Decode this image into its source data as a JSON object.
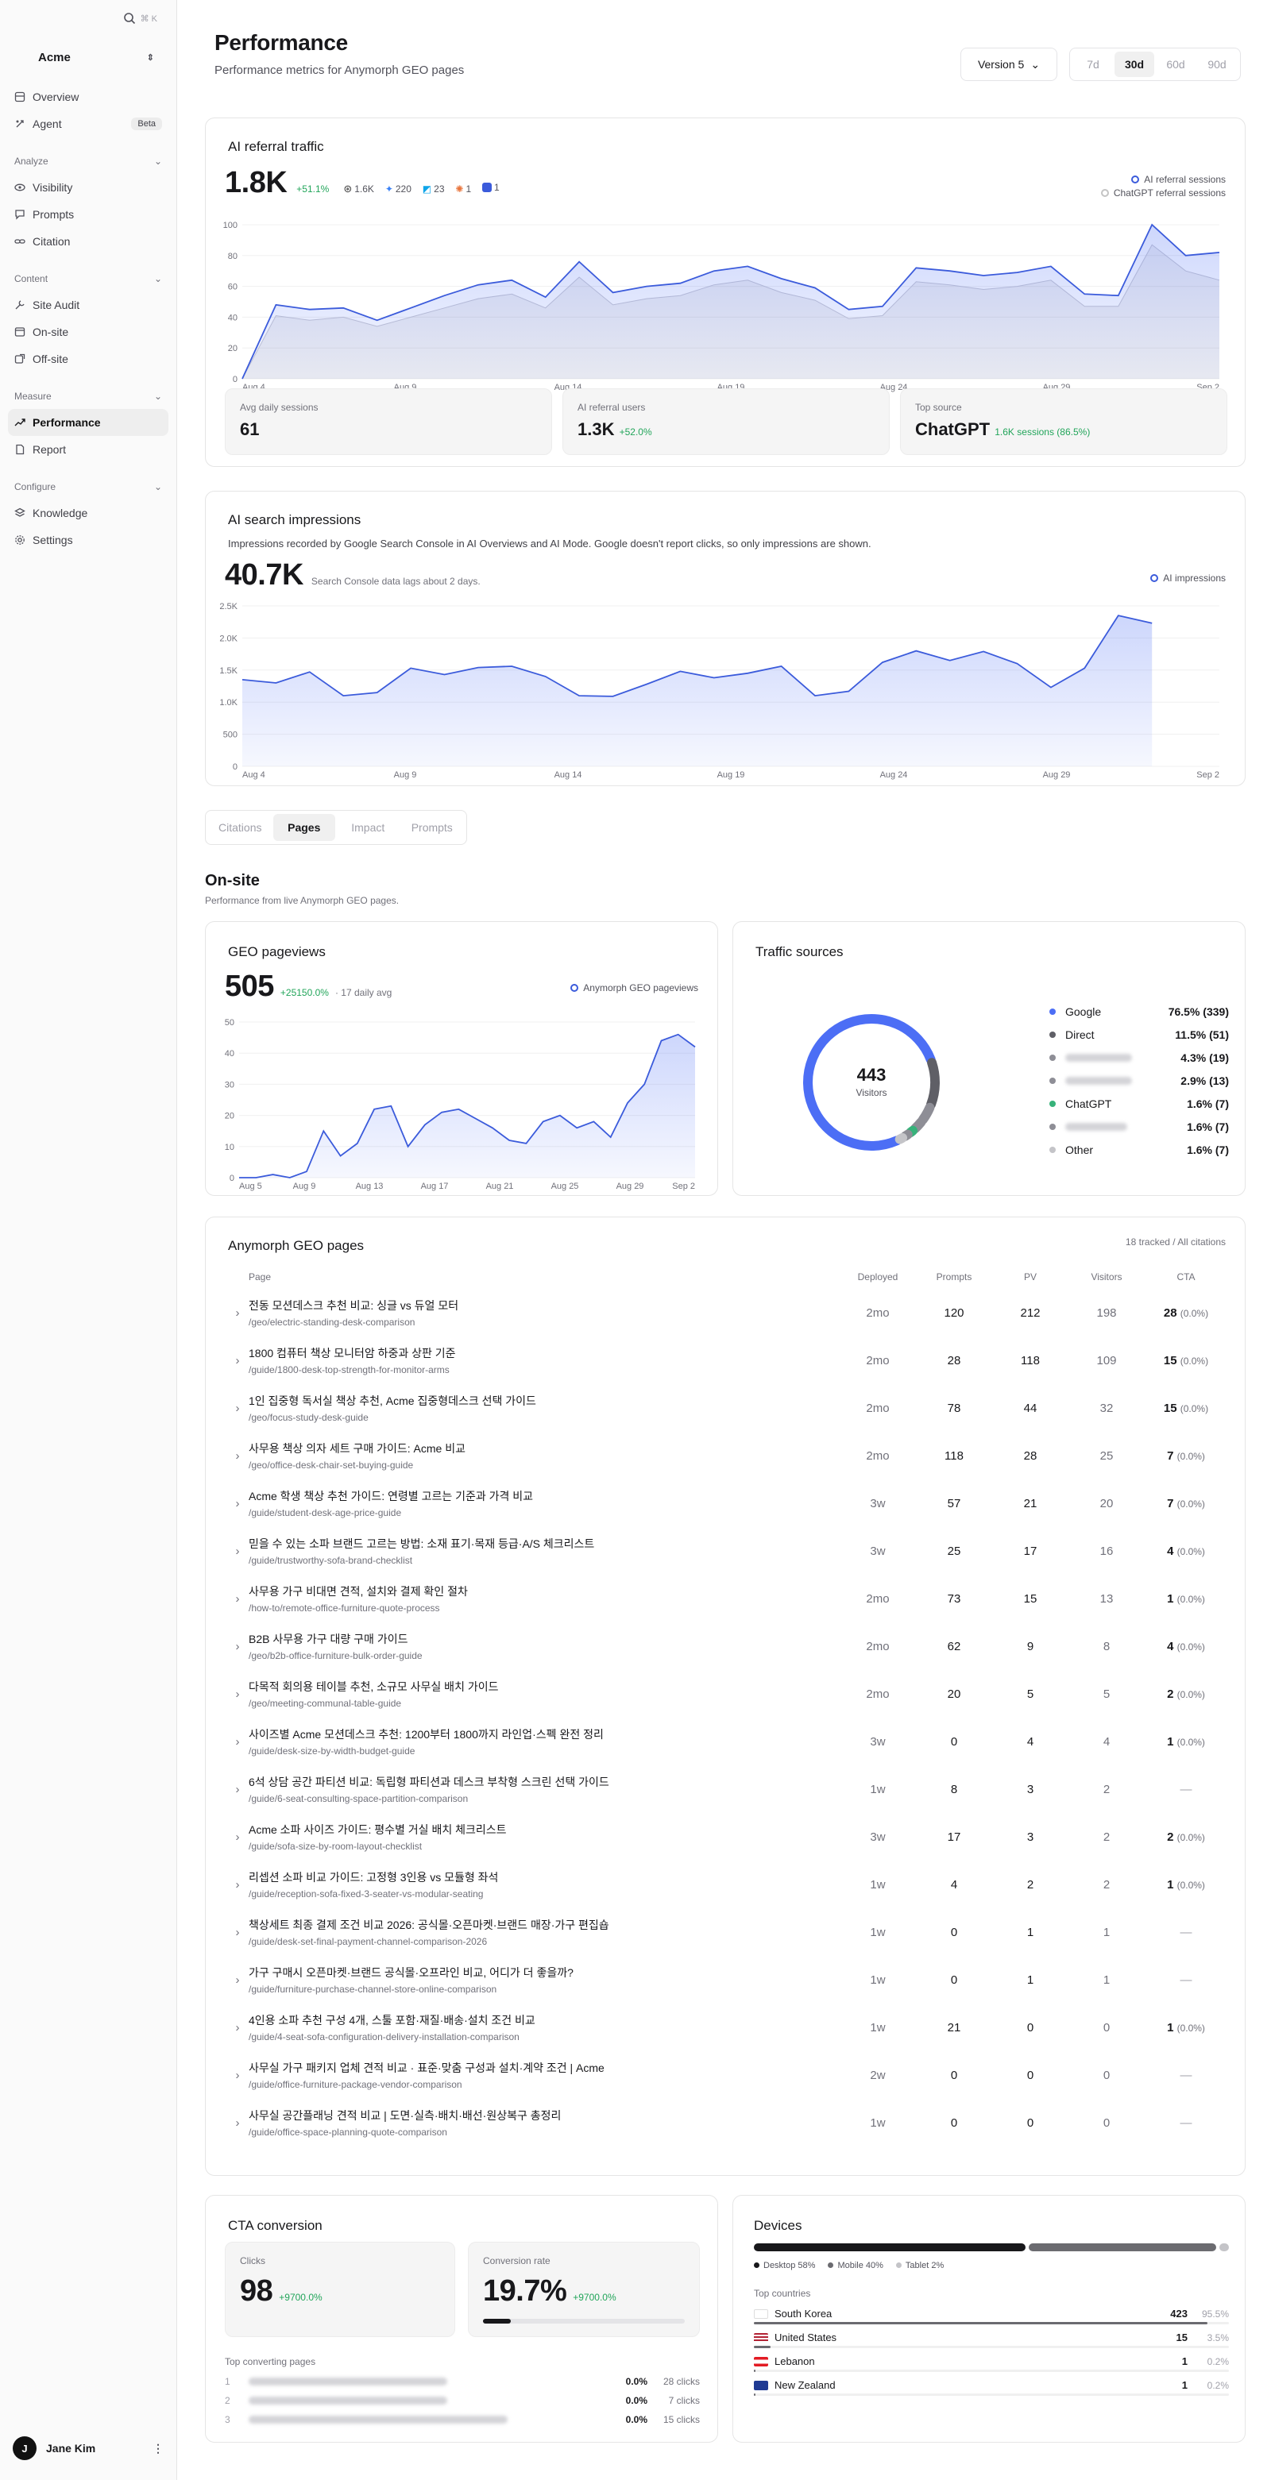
{
  "sidebar": {
    "search_kbd": "⌘ K",
    "org": "Acme",
    "items_top": [
      {
        "label": "Overview",
        "icon": "home-icon"
      },
      {
        "label": "Agent",
        "icon": "agent-icon",
        "badge": "Beta"
      }
    ],
    "groups": [
      {
        "label": "Analyze",
        "items": [
          "Visibility",
          "Prompts",
          "Citation"
        ]
      },
      {
        "label": "Content",
        "items": [
          "Site Audit",
          "On-site",
          "Off-site"
        ]
      },
      {
        "label": "Measure",
        "items": [
          "Performance",
          "Report"
        ]
      },
      {
        "label": "Configure",
        "items": [
          "Knowledge",
          "Settings"
        ]
      }
    ],
    "user": {
      "initial": "J",
      "name": "Jane Kim"
    }
  },
  "header": {
    "title": "Performance",
    "subtitle": "Performance metrics for Anymorph GEO pages",
    "version": "Version 5",
    "ranges": [
      "7d",
      "30d",
      "60d",
      "90d"
    ],
    "active_range": "30d"
  },
  "referral": {
    "title": "AI referral traffic",
    "value": "1.8K",
    "delta": "+51.1%",
    "chips": [
      {
        "icon": "openai-icon",
        "v": "1.6K"
      },
      {
        "icon": "perplexity-icon",
        "v": "220"
      },
      {
        "icon": "copilot-icon",
        "v": "23"
      },
      {
        "icon": "claude-icon",
        "v": "1"
      },
      {
        "icon": "gemini-icon",
        "v": "1"
      }
    ],
    "legend": [
      "AI referral sessions",
      "ChatGPT referral sessions"
    ],
    "stats": [
      {
        "label": "Avg daily sessions",
        "value": "61",
        "extra": ""
      },
      {
        "label": "AI referral users",
        "value": "1.3K",
        "extra": "+52.0%"
      },
      {
        "label": "Top source",
        "value": "ChatGPT",
        "extra": "1.6K sessions (86.5%)"
      }
    ]
  },
  "impressions": {
    "title": "AI search impressions",
    "desc": "Impressions recorded by Google Search Console in AI Overviews and AI Mode. Google doesn't report clicks, so only impressions are shown.",
    "value": "40.7K",
    "note": "Search Console data lags about 2 days.",
    "legend": "AI impressions"
  },
  "tabs": [
    "Citations",
    "Pages",
    "Impact",
    "Prompts"
  ],
  "active_tab": "Pages",
  "onsite": {
    "title": "On-site",
    "subtitle": "Performance from live Anymorph GEO pages."
  },
  "geo_pv": {
    "title": "GEO pageviews",
    "value": "505",
    "delta": "+25150.0%",
    "avg": "· 17 daily avg",
    "legend": "Anymorph GEO pageviews"
  },
  "traffic": {
    "title": "Traffic sources",
    "center_value": "443",
    "center_label": "Visitors",
    "rows": [
      {
        "name": "Google",
        "value": "76.5% (339)",
        "color": "#4c6ef5",
        "hidden": false
      },
      {
        "name": "Direct",
        "value": "11.5% (51)",
        "color": "#5f5f66",
        "hidden": false
      },
      {
        "name": "",
        "value": "4.3% (19)",
        "color": "#8e8e96",
        "hidden": true
      },
      {
        "name": "",
        "value": "2.9% (13)",
        "color": "#8e8e96",
        "hidden": true
      },
      {
        "name": "ChatGPT",
        "value": "1.6% (7)",
        "color": "#37b27a",
        "hidden": false
      },
      {
        "name": "",
        "value": "1.6% (7)",
        "color": "#8e8e96",
        "hidden": true
      },
      {
        "name": "Other",
        "value": "1.6% (7)",
        "color": "#c4c4c8",
        "hidden": false
      }
    ]
  },
  "pages_table": {
    "title": "Anymorph GEO pages",
    "meta": "18 tracked / All citations",
    "headers": [
      "Page",
      "Deployed",
      "Prompts",
      "PV",
      "Visitors",
      "CTA"
    ],
    "rows": [
      {
        "t": "전동 모션데스크 추천 비교: 싱글 vs 듀얼 모터",
        "u": "/geo/electric-standing-desk-comparison",
        "d": "2mo",
        "p": "120",
        "pv": "212",
        "v": "198",
        "c": "28",
        "cp": "(0.0%)"
      },
      {
        "t": "1800 컴퓨터 책상 모니터암 하중과 상판 기준",
        "u": "/guide/1800-desk-top-strength-for-monitor-arms",
        "d": "2mo",
        "p": "28",
        "pv": "118",
        "v": "109",
        "c": "15",
        "cp": "(0.0%)"
      },
      {
        "t": "1인 집중형 독서실 책상 추천, Acme 집중형데스크 선택 가이드",
        "u": "/geo/focus-study-desk-guide",
        "d": "2mo",
        "p": "78",
        "pv": "44",
        "v": "32",
        "c": "15",
        "cp": "(0.0%)"
      },
      {
        "t": "사무용 책상 의자 세트 구매 가이드: Acme 비교",
        "u": "/geo/office-desk-chair-set-buying-guide",
        "d": "2mo",
        "p": "118",
        "pv": "28",
        "v": "25",
        "c": "7",
        "cp": "(0.0%)"
      },
      {
        "t": "Acme 학생 책상 추천 가이드: 연령별 고르는 기준과 가격 비교",
        "u": "/guide/student-desk-age-price-guide",
        "d": "3w",
        "p": "57",
        "pv": "21",
        "v": "20",
        "c": "7",
        "cp": "(0.0%)"
      },
      {
        "t": "믿을 수 있는 소파 브랜드 고르는 방법: 소재 표기·목재 등급·A/S 체크리스트",
        "u": "/guide/trustworthy-sofa-brand-checklist",
        "d": "3w",
        "p": "25",
        "pv": "17",
        "v": "16",
        "c": "4",
        "cp": "(0.0%)"
      },
      {
        "t": "사무용 가구 비대면 견적, 설치와 결제 확인 절차",
        "u": "/how-to/remote-office-furniture-quote-process",
        "d": "2mo",
        "p": "73",
        "pv": "15",
        "v": "13",
        "c": "1",
        "cp": "(0.0%)"
      },
      {
        "t": "B2B 사무용 가구 대량 구매 가이드",
        "u": "/geo/b2b-office-furniture-bulk-order-guide",
        "d": "2mo",
        "p": "62",
        "pv": "9",
        "v": "8",
        "c": "4",
        "cp": "(0.0%)"
      },
      {
        "t": "다목적 회의용 테이블 추천, 소규모 사무실 배치 가이드",
        "u": "/geo/meeting-communal-table-guide",
        "d": "2mo",
        "p": "20",
        "pv": "5",
        "v": "5",
        "c": "2",
        "cp": "(0.0%)"
      },
      {
        "t": "사이즈별 Acme 모션데스크 추천: 1200부터 1800까지 라인업·스펙 완전 정리",
        "u": "/guide/desk-size-by-width-budget-guide",
        "d": "3w",
        "p": "0",
        "pv": "4",
        "v": "4",
        "c": "1",
        "cp": "(0.0%)"
      },
      {
        "t": "6석 상담 공간 파티션 비교: 독립형 파티션과 데스크 부착형 스크린 선택 가이드",
        "u": "/guide/6-seat-consulting-space-partition-comparison",
        "d": "1w",
        "p": "8",
        "pv": "3",
        "v": "2",
        "c": "—",
        "cp": ""
      },
      {
        "t": "Acme 소파 사이즈 가이드: 평수별 거실 배치 체크리스트",
        "u": "/guide/sofa-size-by-room-layout-checklist",
        "d": "3w",
        "p": "17",
        "pv": "3",
        "v": "2",
        "c": "2",
        "cp": "(0.0%)"
      },
      {
        "t": "리셉션 소파 비교 가이드: 고정형 3인용 vs 모듈형 좌석",
        "u": "/guide/reception-sofa-fixed-3-seater-vs-modular-seating",
        "d": "1w",
        "p": "4",
        "pv": "2",
        "v": "2",
        "c": "1",
        "cp": "(0.0%)"
      },
      {
        "t": "책상세트 최종 결제 조건 비교 2026: 공식몰·오픈마켓·브랜드 매장·가구 편집숍",
        "u": "/guide/desk-set-final-payment-channel-comparison-2026",
        "d": "1w",
        "p": "0",
        "pv": "1",
        "v": "1",
        "c": "—",
        "cp": ""
      },
      {
        "t": "가구 구매시 오픈마켓·브랜드 공식몰·오프라인 비교, 어디가 더 좋을까?",
        "u": "/guide/furniture-purchase-channel-store-online-comparison",
        "d": "1w",
        "p": "0",
        "pv": "1",
        "v": "1",
        "c": "—",
        "cp": ""
      },
      {
        "t": "4인용 소파 추천 구성 4개, 스툴 포함·재질·배송·설치 조건 비교",
        "u": "/guide/4-seat-sofa-configuration-delivery-installation-comparison",
        "d": "1w",
        "p": "21",
        "pv": "0",
        "v": "0",
        "c": "1",
        "cp": "(0.0%)"
      },
      {
        "t": "사무실 가구 패키지 업체 견적 비교 · 표준·맞춤 구성과 설치·계약 조건 | Acme",
        "u": "/guide/office-furniture-package-vendor-comparison",
        "d": "2w",
        "p": "0",
        "pv": "0",
        "v": "0",
        "c": "—",
        "cp": ""
      },
      {
        "t": "사무실 공간플래닝 견적 비교 | 도면·실측·배치·배선·원상복구 총정리",
        "u": "/guide/office-space-planning-quote-comparison",
        "d": "1w",
        "p": "0",
        "pv": "0",
        "v": "0",
        "c": "—",
        "cp": ""
      }
    ]
  },
  "cta": {
    "title": "CTA conversion",
    "clicks_label": "Clicks",
    "clicks": "98",
    "clicks_delta": "+9700.0%",
    "rate_label": "Conversion rate",
    "rate": "19.7%",
    "rate_delta": "+9700.0%",
    "rate_fraction": 0.197,
    "top_label": "Top converting pages",
    "top": [
      {
        "rank": "1",
        "pct": "0.0%",
        "clicks": "28 clicks"
      },
      {
        "rank": "2",
        "pct": "0.0%",
        "clicks": "7 clicks"
      },
      {
        "rank": "3",
        "pct": "0.0%",
        "clicks": "15 clicks"
      }
    ]
  },
  "devices": {
    "title": "Devices",
    "split": [
      {
        "label": "Desktop 58%",
        "share": 58,
        "color": "#18181b"
      },
      {
        "label": "Mobile 40%",
        "share": 40,
        "color": "#6b6b70"
      },
      {
        "label": "Tablet 2%",
        "share": 2,
        "color": "#c4c4c8"
      }
    ],
    "countries_label": "Top countries",
    "countries": [
      {
        "name": "South Korea",
        "n": "423",
        "p": "95.5%",
        "share": 0.955
      },
      {
        "name": "United States",
        "n": "15",
        "p": "3.5%",
        "share": 0.035
      },
      {
        "name": "Lebanon",
        "n": "1",
        "p": "0.2%",
        "share": 0.002
      },
      {
        "name": "New Zealand",
        "n": "1",
        "p": "0.2%",
        "share": 0.002
      }
    ]
  },
  "chart_data": [
    {
      "type": "area",
      "title": "AI referral traffic",
      "x_range": [
        "Aug 4",
        "Sep 2"
      ],
      "x_ticks": [
        "Aug 4",
        "Aug 9",
        "Aug 14",
        "Aug 19",
        "Aug 24",
        "Aug 29",
        "Sep 2"
      ],
      "ylim": [
        0,
        100
      ],
      "y_ticks": [
        "0",
        "20",
        "40",
        "60",
        "80",
        "100"
      ],
      "legend": "top-right",
      "series": [
        {
          "name": "AI referral sessions",
          "values": [
            0,
            48,
            45,
            46,
            38,
            46,
            54,
            61,
            64,
            53,
            76,
            56,
            60,
            62,
            70,
            73,
            65,
            59,
            45,
            47,
            72,
            70,
            67,
            69,
            73,
            55,
            54,
            100,
            80,
            82
          ]
        },
        {
          "name": "ChatGPT referral sessions",
          "values": [
            0,
            41,
            38,
            40,
            34,
            40,
            46,
            52,
            55,
            46,
            66,
            48,
            52,
            54,
            61,
            64,
            56,
            51,
            39,
            41,
            63,
            61,
            58,
            60,
            64,
            47,
            47,
            87,
            70,
            64
          ]
        }
      ]
    },
    {
      "type": "area",
      "title": "AI search impressions",
      "x_ticks": [
        "Aug 4",
        "Aug 9",
        "Aug 14",
        "Aug 19",
        "Aug 24",
        "Aug 29",
        "Sep 2"
      ],
      "ylim": [
        0,
        2500
      ],
      "y_ticks": [
        "0",
        "500",
        "1.0K",
        "1.5K",
        "2.0K",
        "2.5K"
      ],
      "legend": "top-right",
      "series": [
        {
          "name": "AI impressions",
          "values": [
            1350,
            1300,
            1470,
            1100,
            1150,
            1530,
            1430,
            1540,
            1560,
            1400,
            1100,
            1090,
            1280,
            1480,
            1380,
            1450,
            1560,
            1100,
            1170,
            1620,
            1800,
            1650,
            1790,
            1600,
            1230,
            1530,
            2350,
            2230
          ]
        }
      ]
    },
    {
      "type": "area",
      "title": "GEO pageviews",
      "x_ticks": [
        "Aug 5",
        "Aug 9",
        "Aug 13",
        "Aug 17",
        "Aug 21",
        "Aug 25",
        "Aug 29",
        "Sep 2"
      ],
      "ylim": [
        0,
        50
      ],
      "y_ticks": [
        "0",
        "10",
        "20",
        "30",
        "40",
        "50"
      ],
      "legend": "top-right",
      "series": [
        {
          "name": "Anymorph GEO pageviews",
          "values": [
            0,
            0,
            1,
            0,
            2,
            15,
            7,
            11,
            22,
            23,
            10,
            17,
            21,
            22,
            19,
            16,
            12,
            11,
            18,
            20,
            16,
            18,
            13,
            24,
            30,
            44,
            46,
            42
          ]
        }
      ]
    },
    {
      "type": "pie",
      "title": "Traffic sources",
      "total": 443,
      "values": [
        339,
        51,
        19,
        13,
        7,
        7,
        7
      ]
    }
  ]
}
